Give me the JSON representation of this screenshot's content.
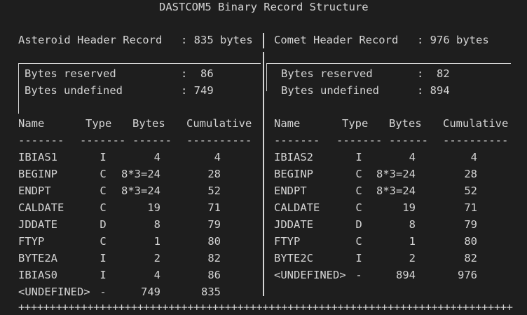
{
  "title": "DASTCOM5 Binary Record Structure",
  "asteroid": {
    "header_label": "Asteroid Header Record",
    "header_bytes": ": 835 bytes",
    "reserved_label": "Bytes reserved",
    "reserved_value": ":  86",
    "undefined_label": "Bytes undefined",
    "undefined_value": ": 749",
    "rows": [
      {
        "name": "IBIAS1",
        "type": "I",
        "bytes": "4",
        "cum": "4"
      },
      {
        "name": "BEGINP",
        "type": "C",
        "bytes": "8*3=24",
        "cum": "28"
      },
      {
        "name": "ENDPT",
        "type": "C",
        "bytes": "8*3=24",
        "cum": "52"
      },
      {
        "name": "CALDATE",
        "type": "C",
        "bytes": "19",
        "cum": "71"
      },
      {
        "name": "JDDATE",
        "type": "D",
        "bytes": "8",
        "cum": "79"
      },
      {
        "name": "FTYP",
        "type": "C",
        "bytes": "1",
        "cum": "80"
      },
      {
        "name": "BYTE2A",
        "type": "I",
        "bytes": "2",
        "cum": "82"
      },
      {
        "name": "IBIAS0",
        "type": "I",
        "bytes": "4",
        "cum": "86"
      },
      {
        "name": "<UNDEFINED>",
        "type": "-",
        "bytes": "749",
        "cum": "835"
      }
    ]
  },
  "comet": {
    "header_label": "Comet Header Record",
    "header_bytes": ": 976 bytes",
    "reserved_label": "Bytes reserved",
    "reserved_value": ":  82",
    "undefined_label": "Bytes undefined",
    "undefined_value": ": 894",
    "rows": [
      {
        "name": "IBIAS2",
        "type": "I",
        "bytes": "4",
        "cum": "4"
      },
      {
        "name": "BEGINP",
        "type": "C",
        "bytes": "8*3=24",
        "cum": "28"
      },
      {
        "name": "ENDPT",
        "type": "C",
        "bytes": "8*3=24",
        "cum": "52"
      },
      {
        "name": "CALDATE",
        "type": "C",
        "bytes": "19",
        "cum": "71"
      },
      {
        "name": "JDDATE",
        "type": "D",
        "bytes": "8",
        "cum": "79"
      },
      {
        "name": "FTYP",
        "type": "C",
        "bytes": "1",
        "cum": "80"
      },
      {
        "name": "BYTE2C",
        "type": "I",
        "bytes": "2",
        "cum": "82"
      },
      {
        "name": "<UNDEFINED>",
        "type": "-",
        "bytes": "894",
        "cum": "976"
      }
    ]
  },
  "columns": {
    "name": "Name",
    "type": "Type",
    "bytes": "Bytes",
    "cum": "Cumulative"
  },
  "dashes": {
    "name": "-------",
    "type": "-------",
    "bytes": "------",
    "cum": "----------"
  },
  "footer": "++++++++++++++++++++++++++++++++++++++++++++++++++++++++++++++++++++++++++++++++++++"
}
